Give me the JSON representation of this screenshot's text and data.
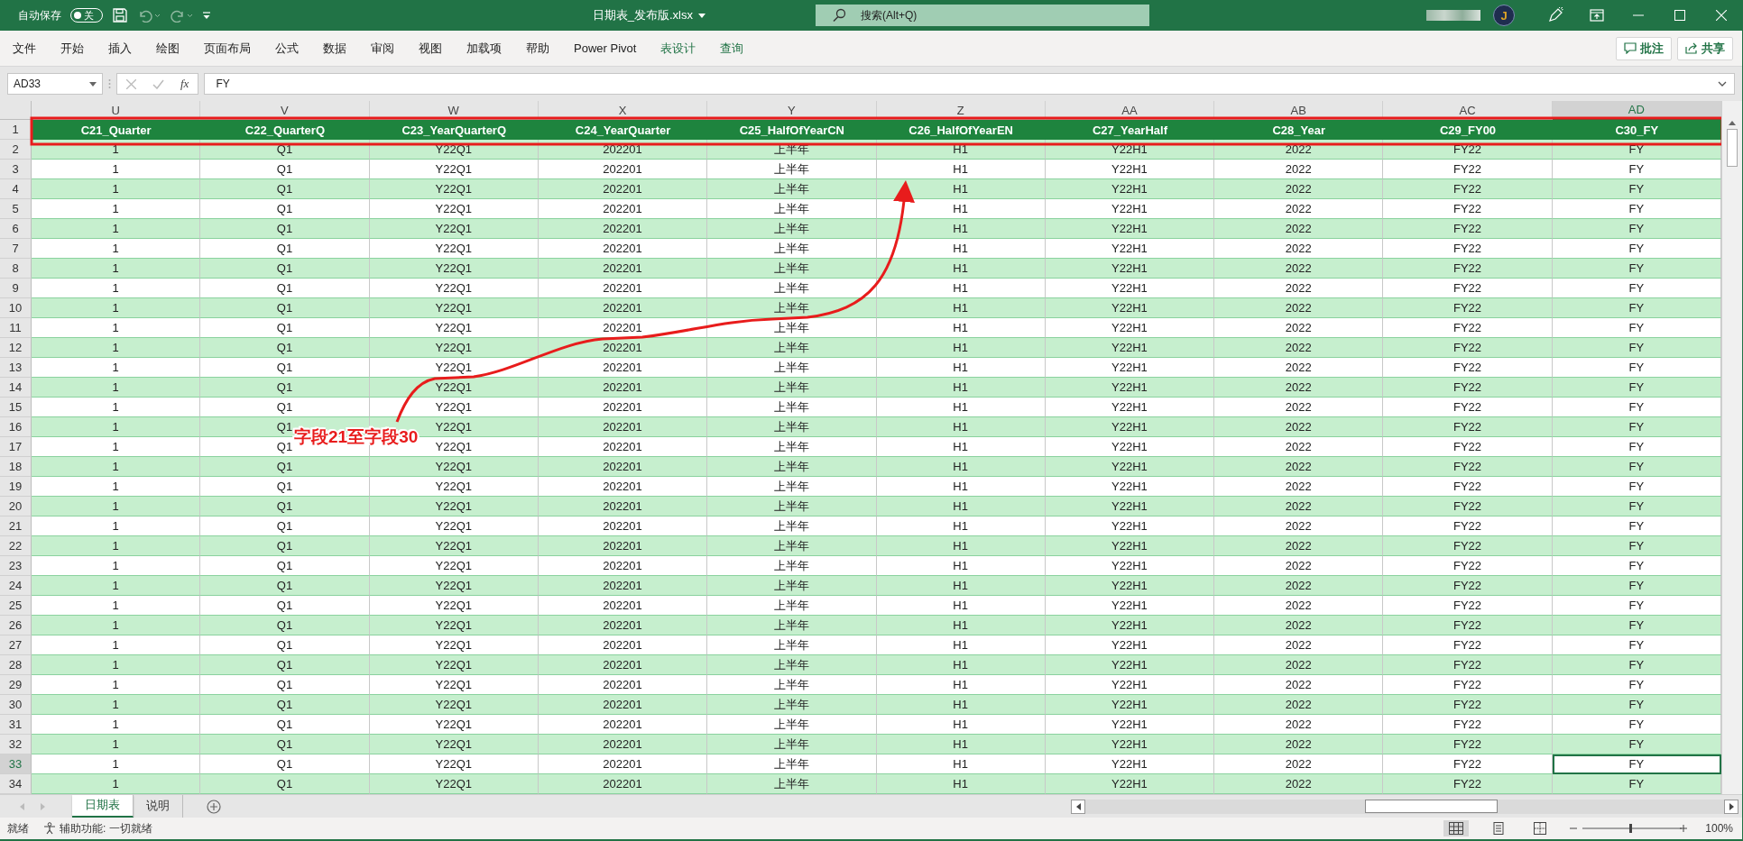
{
  "title_bar": {
    "autosave_label": "自动保存",
    "autosave_toggle": {
      "on": false,
      "label": "关"
    },
    "file_title": "日期表_发布版.xlsx",
    "search": {
      "placeholder": "搜索(Alt+Q)"
    },
    "avatar": "J"
  },
  "ribbon_tabs": [
    {
      "label": "文件",
      "kind": "standard"
    },
    {
      "label": "开始",
      "kind": "standard"
    },
    {
      "label": "插入",
      "kind": "standard"
    },
    {
      "label": "绘图",
      "kind": "standard"
    },
    {
      "label": "页面布局",
      "kind": "standard"
    },
    {
      "label": "公式",
      "kind": "standard"
    },
    {
      "label": "数据",
      "kind": "standard"
    },
    {
      "label": "审阅",
      "kind": "standard"
    },
    {
      "label": "视图",
      "kind": "standard"
    },
    {
      "label": "加载项",
      "kind": "standard"
    },
    {
      "label": "帮助",
      "kind": "standard"
    },
    {
      "label": "Power Pivot",
      "kind": "standard"
    },
    {
      "label": "表设计",
      "kind": "contextual"
    },
    {
      "label": "查询",
      "kind": "contextual"
    }
  ],
  "ribbon_buttons": [
    {
      "label": "批注",
      "kind": "comment"
    },
    {
      "label": "共享",
      "kind": "share"
    }
  ],
  "formula_bar": {
    "name_box": "AD33",
    "function_label": "fx",
    "value": "FY"
  },
  "sheet": {
    "columns": [
      {
        "label": "U",
        "selected": false
      },
      {
        "label": "V",
        "selected": false
      },
      {
        "label": "W",
        "selected": false
      },
      {
        "label": "X",
        "selected": false
      },
      {
        "label": "Y",
        "selected": false
      },
      {
        "label": "Z",
        "selected": false
      },
      {
        "label": "AA",
        "selected": false
      },
      {
        "label": "AB",
        "selected": false
      },
      {
        "label": "AC",
        "selected": false
      },
      {
        "label": "AD",
        "selected": true
      }
    ],
    "header_row": {
      "number": "1",
      "cells": [
        "C21_Quarter",
        "C22_QuarterQ",
        "C23_YearQuarterQ",
        "C24_YearQuarter",
        "C25_HalfOfYearCN",
        "C26_HalfOfYearEN",
        "C27_YearHalf",
        "C28_Year",
        "C29_FY00",
        "C30_FY"
      ]
    },
    "rows": [
      {
        "number": "2",
        "selected": false,
        "cells": [
          "1",
          "Q1",
          "Y22Q1",
          "202201",
          "上半年",
          "H1",
          "Y22H1",
          "2022",
          "FY22",
          "FY"
        ]
      },
      {
        "number": "3",
        "selected": false,
        "cells": [
          "1",
          "Q1",
          "Y22Q1",
          "202201",
          "上半年",
          "H1",
          "Y22H1",
          "2022",
          "FY22",
          "FY"
        ]
      },
      {
        "number": "4",
        "selected": false,
        "cells": [
          "1",
          "Q1",
          "Y22Q1",
          "202201",
          "上半年",
          "H1",
          "Y22H1",
          "2022",
          "FY22",
          "FY"
        ]
      },
      {
        "number": "5",
        "selected": false,
        "cells": [
          "1",
          "Q1",
          "Y22Q1",
          "202201",
          "上半年",
          "H1",
          "Y22H1",
          "2022",
          "FY22",
          "FY"
        ]
      },
      {
        "number": "6",
        "selected": false,
        "cells": [
          "1",
          "Q1",
          "Y22Q1",
          "202201",
          "上半年",
          "H1",
          "Y22H1",
          "2022",
          "FY22",
          "FY"
        ]
      },
      {
        "number": "7",
        "selected": false,
        "cells": [
          "1",
          "Q1",
          "Y22Q1",
          "202201",
          "上半年",
          "H1",
          "Y22H1",
          "2022",
          "FY22",
          "FY"
        ]
      },
      {
        "number": "8",
        "selected": false,
        "cells": [
          "1",
          "Q1",
          "Y22Q1",
          "202201",
          "上半年",
          "H1",
          "Y22H1",
          "2022",
          "FY22",
          "FY"
        ]
      },
      {
        "number": "9",
        "selected": false,
        "cells": [
          "1",
          "Q1",
          "Y22Q1",
          "202201",
          "上半年",
          "H1",
          "Y22H1",
          "2022",
          "FY22",
          "FY"
        ]
      },
      {
        "number": "10",
        "selected": false,
        "cells": [
          "1",
          "Q1",
          "Y22Q1",
          "202201",
          "上半年",
          "H1",
          "Y22H1",
          "2022",
          "FY22",
          "FY"
        ]
      },
      {
        "number": "11",
        "selected": false,
        "cells": [
          "1",
          "Q1",
          "Y22Q1",
          "202201",
          "上半年",
          "H1",
          "Y22H1",
          "2022",
          "FY22",
          "FY"
        ]
      },
      {
        "number": "12",
        "selected": false,
        "cells": [
          "1",
          "Q1",
          "Y22Q1",
          "202201",
          "上半年",
          "H1",
          "Y22H1",
          "2022",
          "FY22",
          "FY"
        ]
      },
      {
        "number": "13",
        "selected": false,
        "cells": [
          "1",
          "Q1",
          "Y22Q1",
          "202201",
          "上半年",
          "H1",
          "Y22H1",
          "2022",
          "FY22",
          "FY"
        ]
      },
      {
        "number": "14",
        "selected": false,
        "cells": [
          "1",
          "Q1",
          "Y22Q1",
          "202201",
          "上半年",
          "H1",
          "Y22H1",
          "2022",
          "FY22",
          "FY"
        ]
      },
      {
        "number": "15",
        "selected": false,
        "cells": [
          "1",
          "Q1",
          "Y22Q1",
          "202201",
          "上半年",
          "H1",
          "Y22H1",
          "2022",
          "FY22",
          "FY"
        ]
      },
      {
        "number": "16",
        "selected": false,
        "cells": [
          "1",
          "Q1",
          "Y22Q1",
          "202201",
          "上半年",
          "H1",
          "Y22H1",
          "2022",
          "FY22",
          "FY"
        ]
      },
      {
        "number": "17",
        "selected": false,
        "cells": [
          "1",
          "Q1",
          "Y22Q1",
          "202201",
          "上半年",
          "H1",
          "Y22H1",
          "2022",
          "FY22",
          "FY"
        ]
      },
      {
        "number": "18",
        "selected": false,
        "cells": [
          "1",
          "Q1",
          "Y22Q1",
          "202201",
          "上半年",
          "H1",
          "Y22H1",
          "2022",
          "FY22",
          "FY"
        ]
      },
      {
        "number": "19",
        "selected": false,
        "cells": [
          "1",
          "Q1",
          "Y22Q1",
          "202201",
          "上半年",
          "H1",
          "Y22H1",
          "2022",
          "FY22",
          "FY"
        ]
      },
      {
        "number": "20",
        "selected": false,
        "cells": [
          "1",
          "Q1",
          "Y22Q1",
          "202201",
          "上半年",
          "H1",
          "Y22H1",
          "2022",
          "FY22",
          "FY"
        ]
      },
      {
        "number": "21",
        "selected": false,
        "cells": [
          "1",
          "Q1",
          "Y22Q1",
          "202201",
          "上半年",
          "H1",
          "Y22H1",
          "2022",
          "FY22",
          "FY"
        ]
      },
      {
        "number": "22",
        "selected": false,
        "cells": [
          "1",
          "Q1",
          "Y22Q1",
          "202201",
          "上半年",
          "H1",
          "Y22H1",
          "2022",
          "FY22",
          "FY"
        ]
      },
      {
        "number": "23",
        "selected": false,
        "cells": [
          "1",
          "Q1",
          "Y22Q1",
          "202201",
          "上半年",
          "H1",
          "Y22H1",
          "2022",
          "FY22",
          "FY"
        ]
      },
      {
        "number": "24",
        "selected": false,
        "cells": [
          "1",
          "Q1",
          "Y22Q1",
          "202201",
          "上半年",
          "H1",
          "Y22H1",
          "2022",
          "FY22",
          "FY"
        ]
      },
      {
        "number": "25",
        "selected": false,
        "cells": [
          "1",
          "Q1",
          "Y22Q1",
          "202201",
          "上半年",
          "H1",
          "Y22H1",
          "2022",
          "FY22",
          "FY"
        ]
      },
      {
        "number": "26",
        "selected": false,
        "cells": [
          "1",
          "Q1",
          "Y22Q1",
          "202201",
          "上半年",
          "H1",
          "Y22H1",
          "2022",
          "FY22",
          "FY"
        ]
      },
      {
        "number": "27",
        "selected": false,
        "cells": [
          "1",
          "Q1",
          "Y22Q1",
          "202201",
          "上半年",
          "H1",
          "Y22H1",
          "2022",
          "FY22",
          "FY"
        ]
      },
      {
        "number": "28",
        "selected": false,
        "cells": [
          "1",
          "Q1",
          "Y22Q1",
          "202201",
          "上半年",
          "H1",
          "Y22H1",
          "2022",
          "FY22",
          "FY"
        ]
      },
      {
        "number": "29",
        "selected": false,
        "cells": [
          "1",
          "Q1",
          "Y22Q1",
          "202201",
          "上半年",
          "H1",
          "Y22H1",
          "2022",
          "FY22",
          "FY"
        ]
      },
      {
        "number": "30",
        "selected": false,
        "cells": [
          "1",
          "Q1",
          "Y22Q1",
          "202201",
          "上半年",
          "H1",
          "Y22H1",
          "2022",
          "FY22",
          "FY"
        ]
      },
      {
        "number": "31",
        "selected": false,
        "cells": [
          "1",
          "Q1",
          "Y22Q1",
          "202201",
          "上半年",
          "H1",
          "Y22H1",
          "2022",
          "FY22",
          "FY"
        ]
      },
      {
        "number": "32",
        "selected": false,
        "cells": [
          "1",
          "Q1",
          "Y22Q1",
          "202201",
          "上半年",
          "H1",
          "Y22H1",
          "2022",
          "FY22",
          "FY"
        ]
      },
      {
        "number": "33",
        "selected": true,
        "cells": [
          "1",
          "Q1",
          "Y22Q1",
          "202201",
          "上半年",
          "H1",
          "Y22H1",
          "2022",
          "FY22",
          "FY"
        ]
      },
      {
        "number": "34",
        "selected": false,
        "cells": [
          "1",
          "Q1",
          "Y22Q1",
          "202201",
          "上半年",
          "H1",
          "Y22H1",
          "2022",
          "FY22",
          "FY"
        ]
      }
    ]
  },
  "annotation": {
    "label": "字段21至字段30"
  },
  "sheet_tabs": [
    {
      "label": "日期表",
      "selected": true
    },
    {
      "label": "说明",
      "selected": false
    }
  ],
  "status_bar": {
    "status": "就绪",
    "accessibility": "辅助功能: 一切就绪",
    "zoom": "100%"
  }
}
